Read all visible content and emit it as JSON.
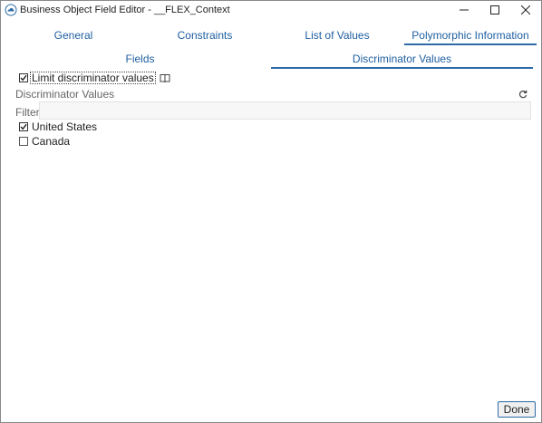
{
  "window": {
    "title": "Business Object Field Editor - __FLEX_Context"
  },
  "tabs": [
    {
      "label": "General",
      "active": false
    },
    {
      "label": "Constraints",
      "active": false
    },
    {
      "label": "List of Values",
      "active": false
    },
    {
      "label": "Polymorphic Information",
      "active": true
    }
  ],
  "subtabs": [
    {
      "label": "Fields",
      "active": false
    },
    {
      "label": "Discriminator Values",
      "active": true
    }
  ],
  "limit_checkbox": {
    "label": "Limit discriminator values",
    "checked": true
  },
  "section": {
    "label": "Discriminator Values"
  },
  "filter": {
    "label": "Filter",
    "value": ""
  },
  "values": [
    {
      "label": "United States",
      "checked": true
    },
    {
      "label": "Canada",
      "checked": false
    }
  ],
  "footer": {
    "done_label": "Done"
  },
  "colors": {
    "accent": "#2d6aa6",
    "tab_text": "#1f5fa1"
  },
  "icons": {
    "app": "cloud-icon",
    "info": "book-icon",
    "refresh": "refresh-icon"
  }
}
